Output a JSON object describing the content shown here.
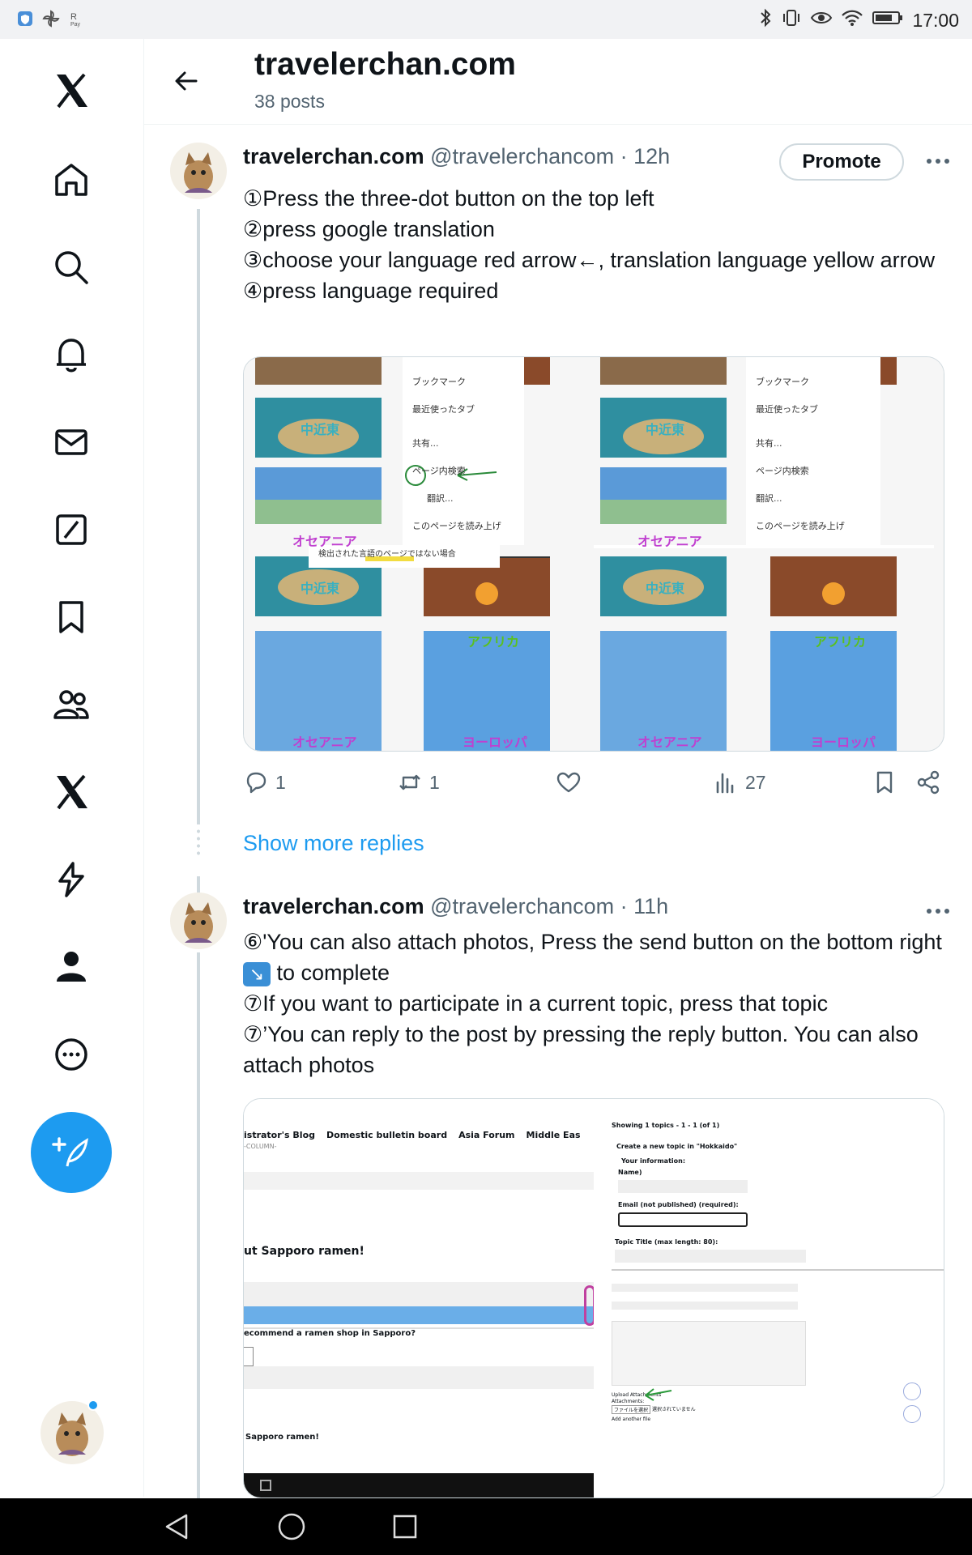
{
  "status_bar": {
    "time": "17:00"
  },
  "header": {
    "title": "travelerchan.com",
    "posts_count": "38 posts"
  },
  "post1": {
    "name": "travelerchan.com",
    "handle": "@travelerchancom",
    "time": "· 12h",
    "promote_label": "Promote",
    "lines": [
      "①Press the three-dot button on the top left",
      "②press google translation",
      "③choose your language red arrow←, translation language yellow arrow",
      "④press language required"
    ],
    "image": {
      "menu_items": [
        "ブックマーク",
        "最近使ったタブ",
        "共有...",
        "ページ内検索",
        "翻訳...",
        "このページを読み上げ"
      ],
      "note": "検出された言語のページではない場合",
      "tile_labels": [
        "中近東",
        "オセアニア",
        "アフリカ",
        "ヨーロッパ"
      ]
    },
    "stats": {
      "replies": "1",
      "reposts": "1",
      "views": "27"
    }
  },
  "show_more_replies": "Show more replies",
  "post2": {
    "name": "travelerchan.com",
    "handle": "@travelerchancom",
    "time": "· 11h",
    "line1_before": "⑥'You can also attach photos, Press the send button on the bottom right ",
    "line1_emoji": "↘",
    "line1_after": " to complete",
    "line2": "⑦If you want to participate in a current topic, press that topic",
    "line3": "⑦’You can reply to the post by pressing the reply button. You can also attach photos",
    "image": {
      "nav_items": [
        "istrator's Blog",
        "Domestic bulletin board",
        "Asia Forum",
        "Middle Eas"
      ],
      "column": "-COLUMN-",
      "heading": "ut Sapporo ramen!",
      "question": "ecommend a ramen shop in Sapporo?",
      "footer_text": "Sapporo ramen!",
      "topics_count": "Showing 1 topics - 1 - 1 (of 1)",
      "create_topic": "Create a new topic in \"Hokkaido\"",
      "your_info": "Your information:",
      "name_label": "Name)",
      "email_label": "Email (not published) (required):",
      "topic_title_label": "Topic Title (max length: 80):",
      "upload_label": "Upload Attachments",
      "attachments_label": "Attachments:",
      "file_button": "ファイルを選択",
      "file_status": "選択されていません",
      "add_another": "Add another file"
    }
  }
}
